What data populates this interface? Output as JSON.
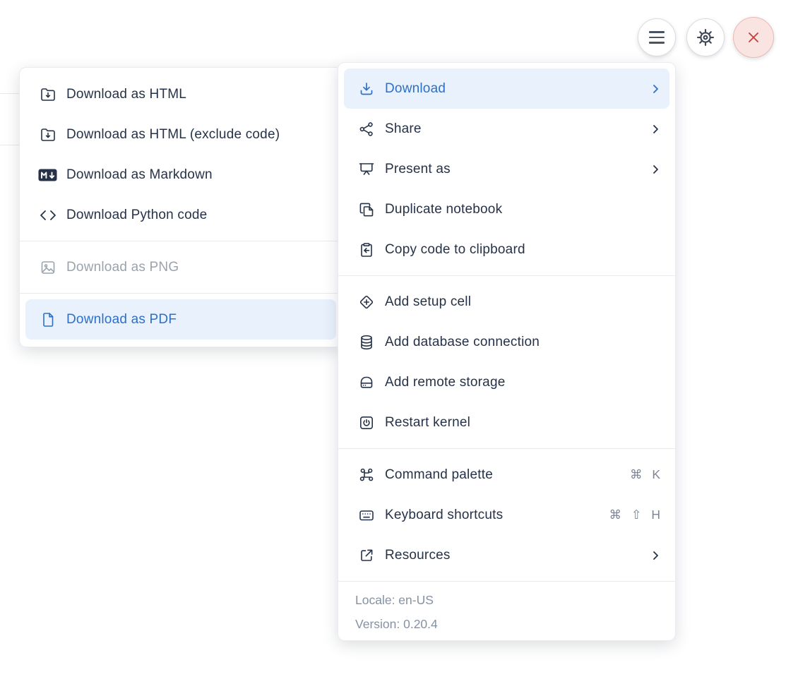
{
  "toolbar": {
    "buttons": [
      {
        "name": "hamburger-menu",
        "icon": "hamburger-icon"
      },
      {
        "name": "settings",
        "icon": "gear-icon"
      },
      {
        "name": "close",
        "icon": "close-icon"
      }
    ]
  },
  "download_submenu": {
    "items": [
      {
        "label": "Download as HTML",
        "icon": "folder-download-icon",
        "state": "normal"
      },
      {
        "label": "Download as HTML (exclude code)",
        "icon": "folder-download-icon",
        "state": "normal"
      },
      {
        "label": "Download as Markdown",
        "icon": "markdown-icon",
        "state": "normal"
      },
      {
        "label": "Download Python code",
        "icon": "code-icon",
        "state": "normal"
      },
      {
        "label": "Download as PNG",
        "icon": "image-icon",
        "state": "disabled"
      },
      {
        "label": "Download as PDF",
        "icon": "file-icon",
        "state": "selected"
      }
    ]
  },
  "main_menu": {
    "group1": [
      {
        "label": "Download",
        "icon": "download-icon",
        "state": "selected",
        "has_submenu": true
      },
      {
        "label": "Share",
        "icon": "share-icon",
        "has_submenu": true
      },
      {
        "label": "Present as",
        "icon": "presentation-icon",
        "has_submenu": true
      },
      {
        "label": "Duplicate notebook",
        "icon": "duplicate-icon"
      },
      {
        "label": "Copy code to clipboard",
        "icon": "clipboard-icon"
      }
    ],
    "group2": [
      {
        "label": "Add setup cell",
        "icon": "diamond-plus-icon"
      },
      {
        "label": "Add database connection",
        "icon": "database-icon"
      },
      {
        "label": "Add remote storage",
        "icon": "storage-icon"
      },
      {
        "label": "Restart kernel",
        "icon": "power-icon"
      }
    ],
    "group3": [
      {
        "label": "Command palette",
        "icon": "command-icon",
        "shortcut": "⌘ K"
      },
      {
        "label": "Keyboard shortcuts",
        "icon": "keyboard-icon",
        "shortcut": "⌘ ⇧ H"
      },
      {
        "label": "Resources",
        "icon": "external-link-icon",
        "has_submenu": true
      }
    ],
    "footer": {
      "locale": "Locale: en-US",
      "version": "Version: 0.20.4"
    }
  },
  "colors": {
    "accent": "#2e6fc7",
    "accent_bg": "#e8f1fc",
    "text": "#263247",
    "muted": "#8492a4",
    "disabled": "#9aa3ad",
    "danger": "#c43d3d",
    "danger_bg": "#f9e4e2",
    "divider": "#e8eaee"
  }
}
